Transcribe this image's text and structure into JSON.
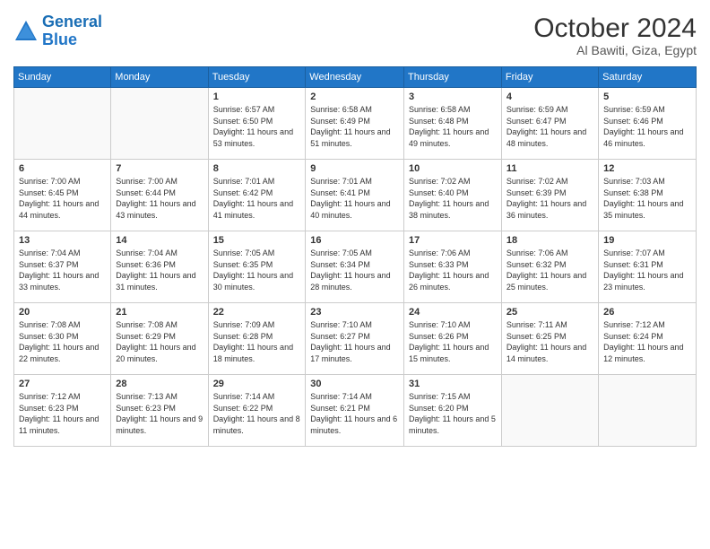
{
  "logo": {
    "line1": "General",
    "line2": "Blue"
  },
  "title": "October 2024",
  "location": "Al Bawiti, Giza, Egypt",
  "headers": [
    "Sunday",
    "Monday",
    "Tuesday",
    "Wednesday",
    "Thursday",
    "Friday",
    "Saturday"
  ],
  "weeks": [
    [
      {
        "day": "",
        "content": ""
      },
      {
        "day": "",
        "content": ""
      },
      {
        "day": "1",
        "content": "Sunrise: 6:57 AM\nSunset: 6:50 PM\nDaylight: 11 hours and 53 minutes."
      },
      {
        "day": "2",
        "content": "Sunrise: 6:58 AM\nSunset: 6:49 PM\nDaylight: 11 hours and 51 minutes."
      },
      {
        "day": "3",
        "content": "Sunrise: 6:58 AM\nSunset: 6:48 PM\nDaylight: 11 hours and 49 minutes."
      },
      {
        "day": "4",
        "content": "Sunrise: 6:59 AM\nSunset: 6:47 PM\nDaylight: 11 hours and 48 minutes."
      },
      {
        "day": "5",
        "content": "Sunrise: 6:59 AM\nSunset: 6:46 PM\nDaylight: 11 hours and 46 minutes."
      }
    ],
    [
      {
        "day": "6",
        "content": "Sunrise: 7:00 AM\nSunset: 6:45 PM\nDaylight: 11 hours and 44 minutes."
      },
      {
        "day": "7",
        "content": "Sunrise: 7:00 AM\nSunset: 6:44 PM\nDaylight: 11 hours and 43 minutes."
      },
      {
        "day": "8",
        "content": "Sunrise: 7:01 AM\nSunset: 6:42 PM\nDaylight: 11 hours and 41 minutes."
      },
      {
        "day": "9",
        "content": "Sunrise: 7:01 AM\nSunset: 6:41 PM\nDaylight: 11 hours and 40 minutes."
      },
      {
        "day": "10",
        "content": "Sunrise: 7:02 AM\nSunset: 6:40 PM\nDaylight: 11 hours and 38 minutes."
      },
      {
        "day": "11",
        "content": "Sunrise: 7:02 AM\nSunset: 6:39 PM\nDaylight: 11 hours and 36 minutes."
      },
      {
        "day": "12",
        "content": "Sunrise: 7:03 AM\nSunset: 6:38 PM\nDaylight: 11 hours and 35 minutes."
      }
    ],
    [
      {
        "day": "13",
        "content": "Sunrise: 7:04 AM\nSunset: 6:37 PM\nDaylight: 11 hours and 33 minutes."
      },
      {
        "day": "14",
        "content": "Sunrise: 7:04 AM\nSunset: 6:36 PM\nDaylight: 11 hours and 31 minutes."
      },
      {
        "day": "15",
        "content": "Sunrise: 7:05 AM\nSunset: 6:35 PM\nDaylight: 11 hours and 30 minutes."
      },
      {
        "day": "16",
        "content": "Sunrise: 7:05 AM\nSunset: 6:34 PM\nDaylight: 11 hours and 28 minutes."
      },
      {
        "day": "17",
        "content": "Sunrise: 7:06 AM\nSunset: 6:33 PM\nDaylight: 11 hours and 26 minutes."
      },
      {
        "day": "18",
        "content": "Sunrise: 7:06 AM\nSunset: 6:32 PM\nDaylight: 11 hours and 25 minutes."
      },
      {
        "day": "19",
        "content": "Sunrise: 7:07 AM\nSunset: 6:31 PM\nDaylight: 11 hours and 23 minutes."
      }
    ],
    [
      {
        "day": "20",
        "content": "Sunrise: 7:08 AM\nSunset: 6:30 PM\nDaylight: 11 hours and 22 minutes."
      },
      {
        "day": "21",
        "content": "Sunrise: 7:08 AM\nSunset: 6:29 PM\nDaylight: 11 hours and 20 minutes."
      },
      {
        "day": "22",
        "content": "Sunrise: 7:09 AM\nSunset: 6:28 PM\nDaylight: 11 hours and 18 minutes."
      },
      {
        "day": "23",
        "content": "Sunrise: 7:10 AM\nSunset: 6:27 PM\nDaylight: 11 hours and 17 minutes."
      },
      {
        "day": "24",
        "content": "Sunrise: 7:10 AM\nSunset: 6:26 PM\nDaylight: 11 hours and 15 minutes."
      },
      {
        "day": "25",
        "content": "Sunrise: 7:11 AM\nSunset: 6:25 PM\nDaylight: 11 hours and 14 minutes."
      },
      {
        "day": "26",
        "content": "Sunrise: 7:12 AM\nSunset: 6:24 PM\nDaylight: 11 hours and 12 minutes."
      }
    ],
    [
      {
        "day": "27",
        "content": "Sunrise: 7:12 AM\nSunset: 6:23 PM\nDaylight: 11 hours and 11 minutes."
      },
      {
        "day": "28",
        "content": "Sunrise: 7:13 AM\nSunset: 6:23 PM\nDaylight: 11 hours and 9 minutes."
      },
      {
        "day": "29",
        "content": "Sunrise: 7:14 AM\nSunset: 6:22 PM\nDaylight: 11 hours and 8 minutes."
      },
      {
        "day": "30",
        "content": "Sunrise: 7:14 AM\nSunset: 6:21 PM\nDaylight: 11 hours and 6 minutes."
      },
      {
        "day": "31",
        "content": "Sunrise: 7:15 AM\nSunset: 6:20 PM\nDaylight: 11 hours and 5 minutes."
      },
      {
        "day": "",
        "content": ""
      },
      {
        "day": "",
        "content": ""
      }
    ]
  ]
}
